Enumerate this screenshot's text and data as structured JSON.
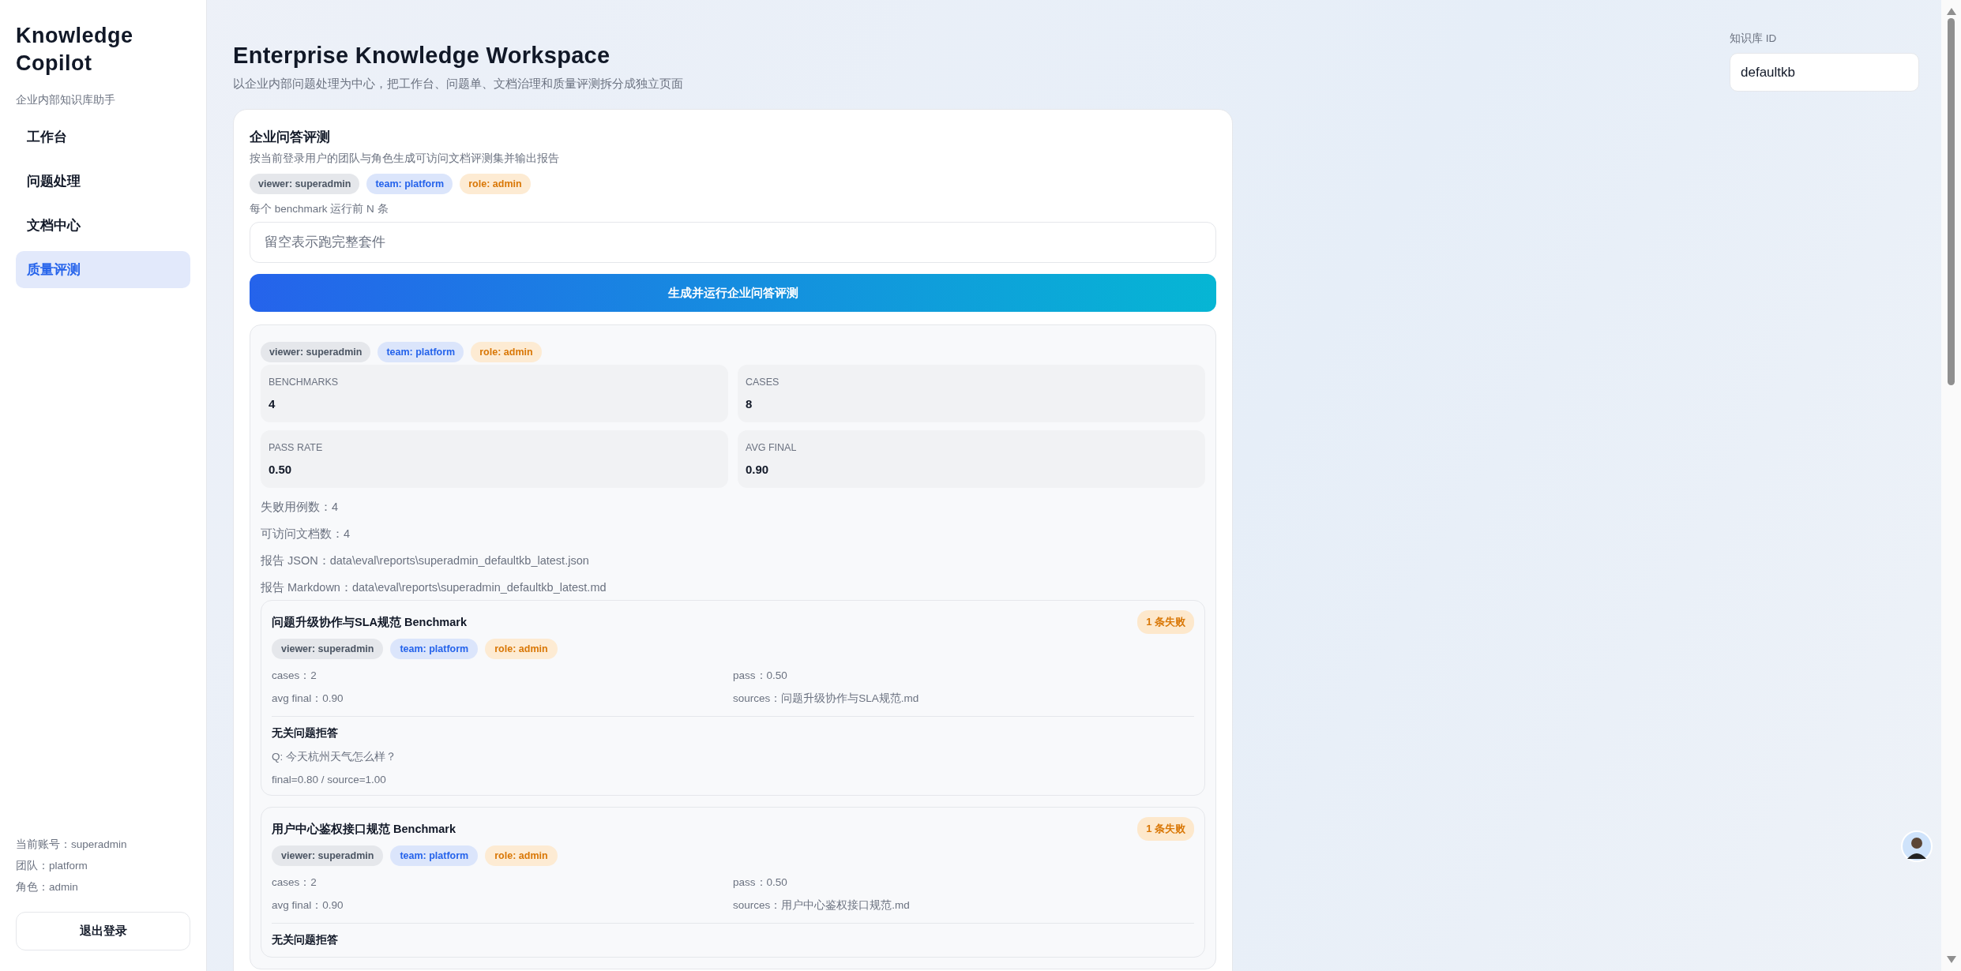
{
  "sidebar": {
    "title": "Knowledge Copilot",
    "subtitle": "企业内部知识库助手",
    "nav": [
      {
        "label": "工作台",
        "selected": false
      },
      {
        "label": "问题处理",
        "selected": false
      },
      {
        "label": "文档中心",
        "selected": false
      },
      {
        "label": "质量评测",
        "selected": true
      }
    ],
    "account": [
      "当前账号：superadmin",
      "团队：platform",
      "角色：admin"
    ],
    "logout": "退出登录"
  },
  "header": {
    "title": "Enterprise Knowledge Workspace",
    "subtitle": "以企业内部问题处理为中心，把工作台、问题单、文档治理和质量评测拆分成独立页面"
  },
  "kb": {
    "label": "知识库 ID",
    "value": "defaultkb"
  },
  "eval": {
    "title": "企业问答评测",
    "description": "按当前登录用户的团队与角色生成可访问文档评测集并输出报告",
    "chips": [
      {
        "text": "viewer: superadmin",
        "kind": "viewer"
      },
      {
        "text": "team: platform",
        "kind": "team"
      },
      {
        "text": "role: admin",
        "kind": "role"
      }
    ],
    "limit_label": "每个 benchmark 运行前 N 条",
    "limit_placeholder": "留空表示跑完整套件",
    "run_button": "生成并运行企业问答评测",
    "result": {
      "chips": [
        {
          "text": "viewer: superadmin",
          "kind": "viewer"
        },
        {
          "text": "team: platform",
          "kind": "team"
        },
        {
          "text": "role: admin",
          "kind": "role"
        }
      ],
      "metrics": [
        {
          "label": "BENCHMARKS",
          "value": "4"
        },
        {
          "label": "CASES",
          "value": "8"
        },
        {
          "label": "PASS RATE",
          "value": "0.50"
        },
        {
          "label": "AVG FINAL",
          "value": "0.90"
        }
      ],
      "lines": [
        "失败用例数：4",
        "可访问文档数：4",
        "报告 JSON：data\\eval\\reports\\superadmin_defaultkb_latest.json",
        "报告 Markdown：data\\eval\\reports\\superadmin_defaultkb_latest.md"
      ],
      "benchmarks": [
        {
          "title": "问题升级协作与SLA规范 Benchmark",
          "badge": "1 条失败",
          "chips": [
            {
              "text": "viewer: superadmin",
              "kind": "viewer"
            },
            {
              "text": "team: platform",
              "kind": "team"
            },
            {
              "text": "role: admin",
              "kind": "role"
            }
          ],
          "stats": [
            "cases：2",
            "pass：0.50",
            "avg final：0.90",
            "sources：问题升级协作与SLA规范.md"
          ],
          "cases": [
            {
              "title": "无关问题拒答",
              "question": "Q: 今天杭州天气怎么样？",
              "scores": "final=0.80 / source=1.00"
            }
          ]
        },
        {
          "title": "用户中心鉴权接口规范 Benchmark",
          "badge": "1 条失败",
          "chips": [
            {
              "text": "viewer: superadmin",
              "kind": "viewer"
            },
            {
              "text": "team: platform",
              "kind": "team"
            },
            {
              "text": "role: admin",
              "kind": "role"
            }
          ],
          "stats": [
            "cases：2",
            "pass：0.50",
            "avg final：0.90",
            "sources：用户中心鉴权接口规范.md"
          ],
          "cases": [
            {
              "title": "无关问题拒答"
            }
          ]
        }
      ]
    }
  }
}
